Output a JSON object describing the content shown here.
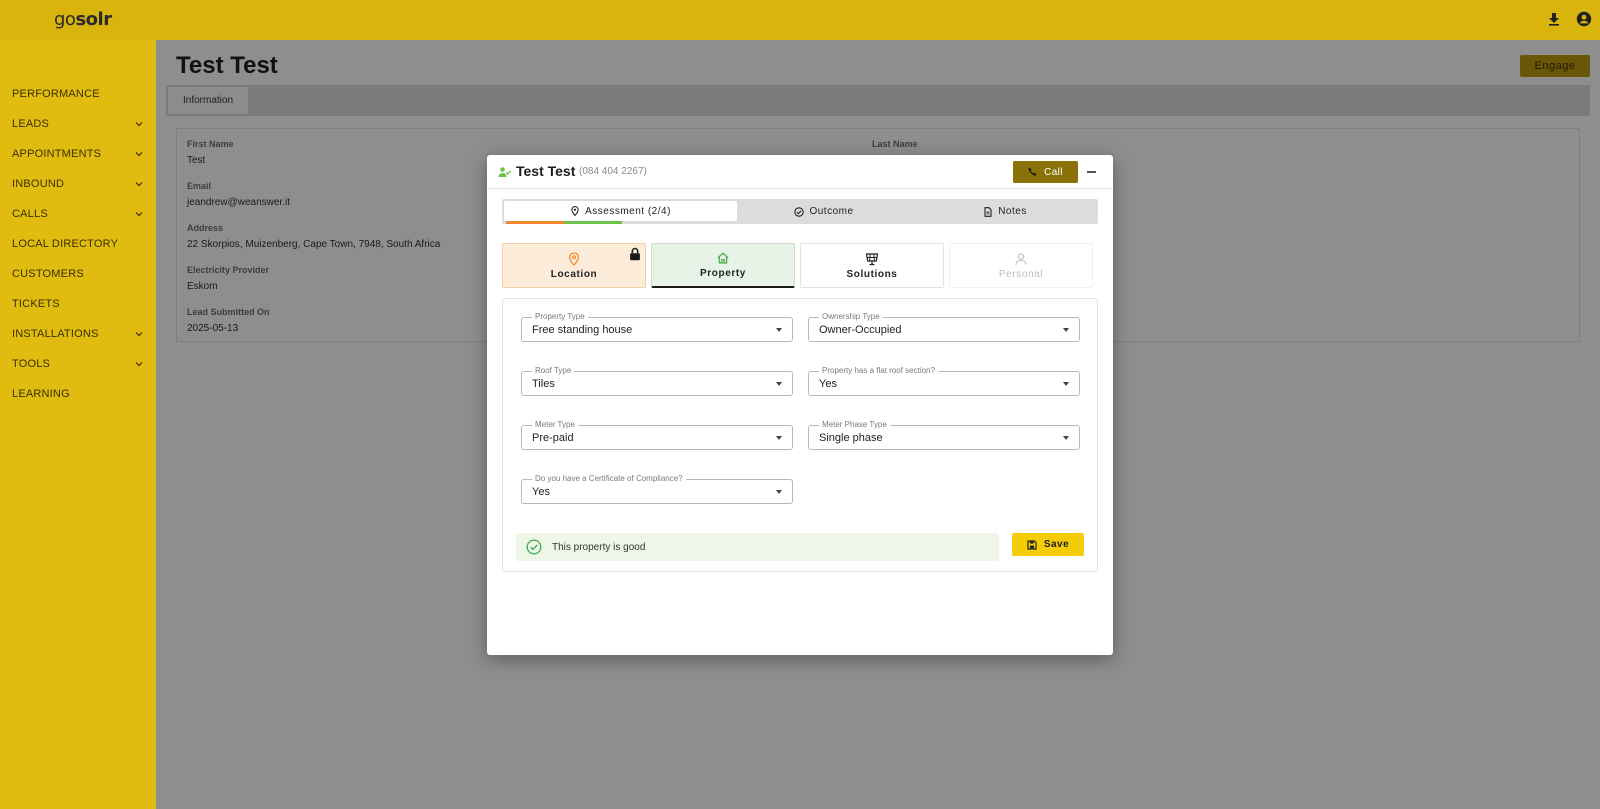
{
  "brand": {
    "logo_prefix": "go",
    "logo_suffix": "solr"
  },
  "topbar": {
    "icons": [
      "download-icon",
      "account-circle-icon"
    ]
  },
  "sidebar": {
    "items": [
      {
        "label": "PERFORMANCE",
        "has_chevron": false
      },
      {
        "label": "LEADS",
        "has_chevron": true
      },
      {
        "label": "APPOINTMENTS",
        "has_chevron": true
      },
      {
        "label": "INBOUND",
        "has_chevron": true
      },
      {
        "label": "CALLS",
        "has_chevron": true
      },
      {
        "label": "LOCAL DIRECTORY",
        "has_chevron": false
      },
      {
        "label": "CUSTOMERS",
        "has_chevron": false
      },
      {
        "label": "TICKETS",
        "has_chevron": false
      },
      {
        "label": "INSTALLATIONS",
        "has_chevron": true
      },
      {
        "label": "TOOLS",
        "has_chevron": true
      },
      {
        "label": "LEARNING",
        "has_chevron": false
      }
    ]
  },
  "page": {
    "title": "Test Test",
    "engage_label": "Engage",
    "tab_label": "Information",
    "fields": {
      "first_name_label": "First Name",
      "first_name": "Test",
      "last_name_label": "Last Name",
      "email_label": "Email",
      "email": "jeandrew@weanswer.it",
      "address_label": "Address",
      "address": "22 Skorpios, Muizenberg, Cape Town, 7948, South Africa",
      "provider_label": "Electricity Provider",
      "provider": "Eskom",
      "submitted_label": "Lead Submitted On",
      "submitted": "2025-05-13"
    }
  },
  "modal": {
    "name": "Test Test",
    "phone": "(084 404 2267)",
    "call_label": "Call",
    "tabs": {
      "assessment": "Assessment (2/4)",
      "outcome": "Outcome",
      "notes": "Notes"
    },
    "steps": {
      "location": "Location",
      "property": "Property",
      "solutions": "Solutions",
      "personal": "Personal"
    },
    "form": {
      "property_type_label": "Property Type",
      "property_type": "Free standing house",
      "ownership_type_label": "Ownership Type",
      "ownership_type": "Owner-Occupied",
      "roof_type_label": "Roof Type",
      "roof_type": "Tiles",
      "flat_roof_label": "Property has a flat roof section?",
      "flat_roof": "Yes",
      "meter_type_label": "Meter Type",
      "meter_type": "Pre-paid",
      "meter_phase_label": "Meter Phase Type",
      "meter_phase": "Single phase",
      "coc_label": "Do you have a Certificate of Compliance?",
      "coc": "Yes"
    },
    "status_message": "This property is good",
    "save_label": "Save"
  },
  "colors": {
    "brand_yellow": "#f5cc0a",
    "progress_orange": "#f08a2c",
    "progress_green": "#6cc24a"
  }
}
